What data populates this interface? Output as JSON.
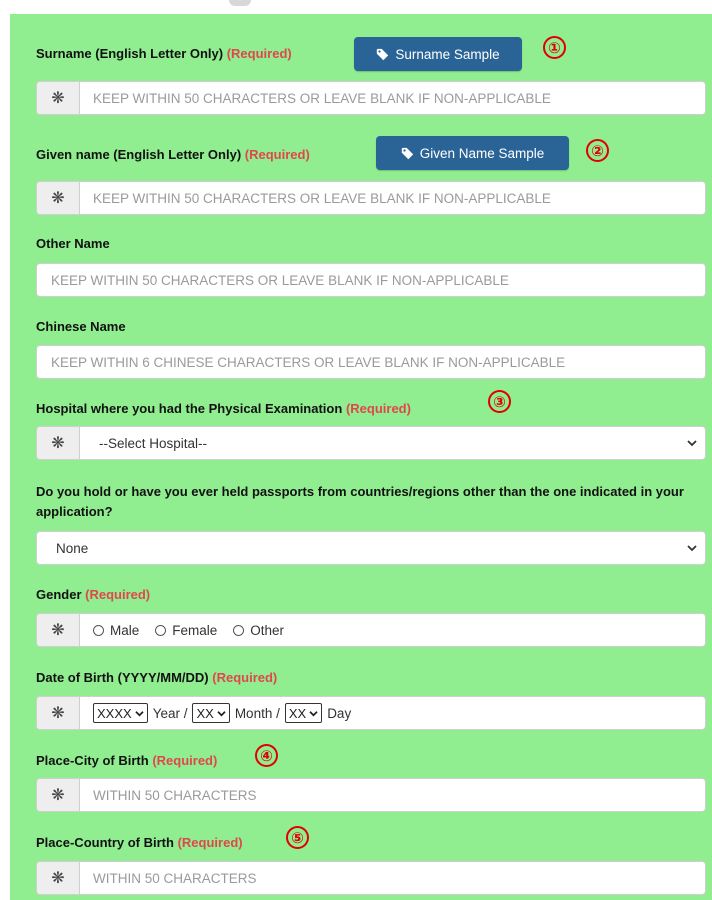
{
  "form": {
    "surname": {
      "label": "Surname (English Letter Only)",
      "required": "(Required)",
      "button": "Surname Sample",
      "marker": "①",
      "placeholder": "KEEP WITHIN 50 CHARACTERS OR LEAVE BLANK IF NON-APPLICABLE",
      "addon": "❋"
    },
    "given_name": {
      "label": "Given name (English Letter Only)",
      "required": "(Required)",
      "button": "Given Name Sample",
      "marker": "②",
      "placeholder": "KEEP WITHIN 50 CHARACTERS OR LEAVE BLANK IF NON-APPLICABLE",
      "addon": "❋"
    },
    "other_name": {
      "label": "Other Name",
      "placeholder": "KEEP WITHIN 50 CHARACTERS OR LEAVE BLANK IF NON-APPLICABLE"
    },
    "chinese_name": {
      "label": "Chinese Name",
      "placeholder": "KEEP WITHIN 6 CHINESE CHARACTERS OR LEAVE BLANK IF NON-APPLICABLE"
    },
    "hospital": {
      "label": "Hospital where you had the Physical Examination",
      "required": "(Required)",
      "marker": "③",
      "selected": "--Select Hospital--",
      "addon": "❋"
    },
    "passports": {
      "label": "Do you hold or have you ever held passports from countries/regions other than the one indicated in your application?",
      "selected": "None"
    },
    "gender": {
      "label": "Gender",
      "required": "(Required)",
      "addon": "❋",
      "options": [
        "Male",
        "Female",
        "Other"
      ]
    },
    "dob": {
      "label": "Date of Birth (YYYY/MM/DD)",
      "required": "(Required)",
      "addon": "❋",
      "year_value": "XXXX",
      "year_label": "Year /",
      "month_value": "XX",
      "month_label": "Month /",
      "day_value": "XX",
      "day_label": "Day"
    },
    "city_of_birth": {
      "label": "Place-City of Birth",
      "required": "(Required)",
      "marker": "④",
      "placeholder": "WITHIN 50 CHARACTERS",
      "addon": "❋"
    },
    "country_of_birth": {
      "label": "Place-Country of Birth",
      "required": "(Required)",
      "marker": "⑤",
      "placeholder": "WITHIN 50 CHARACTERS",
      "addon": "❋"
    }
  },
  "colors": {
    "form_bg": "#90ee90",
    "required": "#e0474c",
    "button": "#2a6496",
    "marker": "#e00000"
  },
  "icons": {
    "tag": "tag-icon",
    "asterisk": "asterisk-icon",
    "chevron": "chevron-down-icon"
  }
}
